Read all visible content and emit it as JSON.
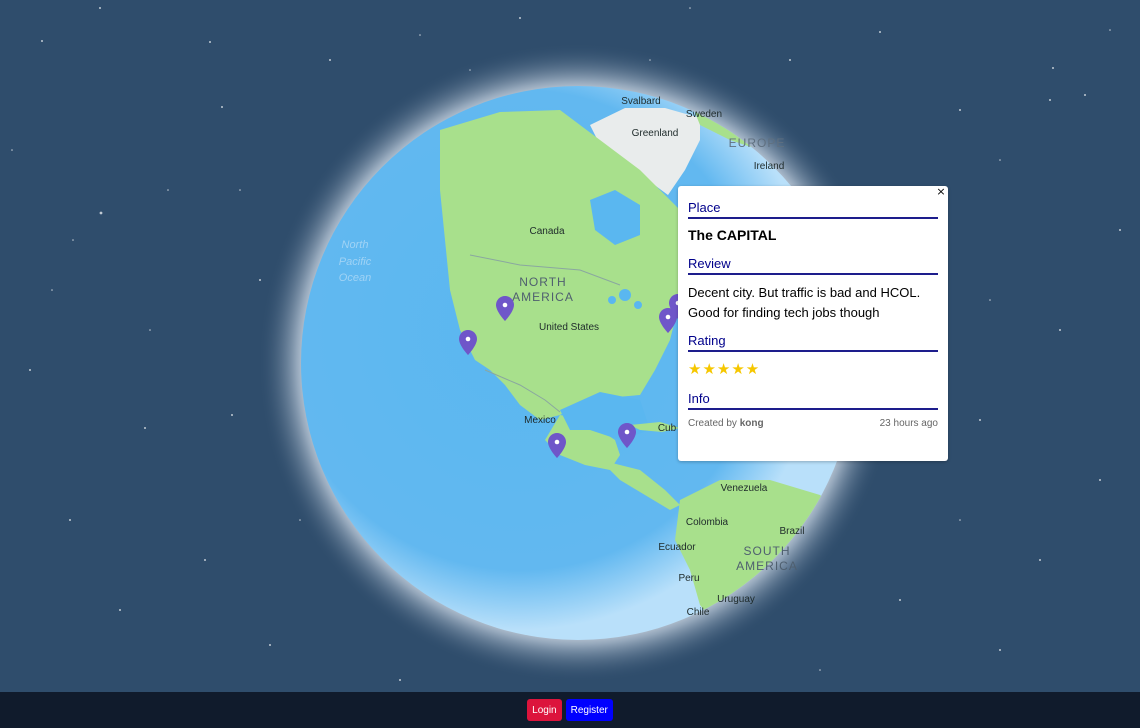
{
  "map": {
    "labels": {
      "svalbard": "Svalbard",
      "sweden": "Sweden",
      "greenland": "Greenland",
      "europe": "EUROPE",
      "ireland": "Ireland",
      "canada": "Canada",
      "north_america_1": "NORTH",
      "north_america_2": "AMERICA",
      "united_states": "United States",
      "pacific_1": "North",
      "pacific_2": "Pacific",
      "pacific_3": "Ocean",
      "mexico": "Mexico",
      "cuba": "Cub",
      "venezuela": "Venezuela",
      "colombia": "Colombia",
      "ecuador": "Ecuador",
      "brazil": "Brazil",
      "south_america_1": "SOUTH",
      "south_america_2": "AMERICA",
      "peru": "Peru",
      "uruguay": "Uruguay",
      "chile": "Chile"
    },
    "marker_color": "#6f56c9"
  },
  "popup": {
    "close_label": "×",
    "place_title": "Place",
    "place_name": "The CAPITAL",
    "review_title": "Review",
    "review_text": "Decent city. But traffic is bad and HCOL. Good for finding tech jobs though",
    "rating_title": "Rating",
    "rating_stars": "★★★★★",
    "rating_value": 5,
    "info_title": "Info",
    "created_by_prefix": "Created by",
    "created_by_user": "kong",
    "created_ago": "23 hours ago"
  },
  "footer": {
    "login_label": "Login",
    "register_label": "Register"
  },
  "colors": {
    "accent_title": "#00008b",
    "star": "#f6c700",
    "login": "#dc143c",
    "register": "#0000ff",
    "footer_bg": "#101b2c"
  }
}
